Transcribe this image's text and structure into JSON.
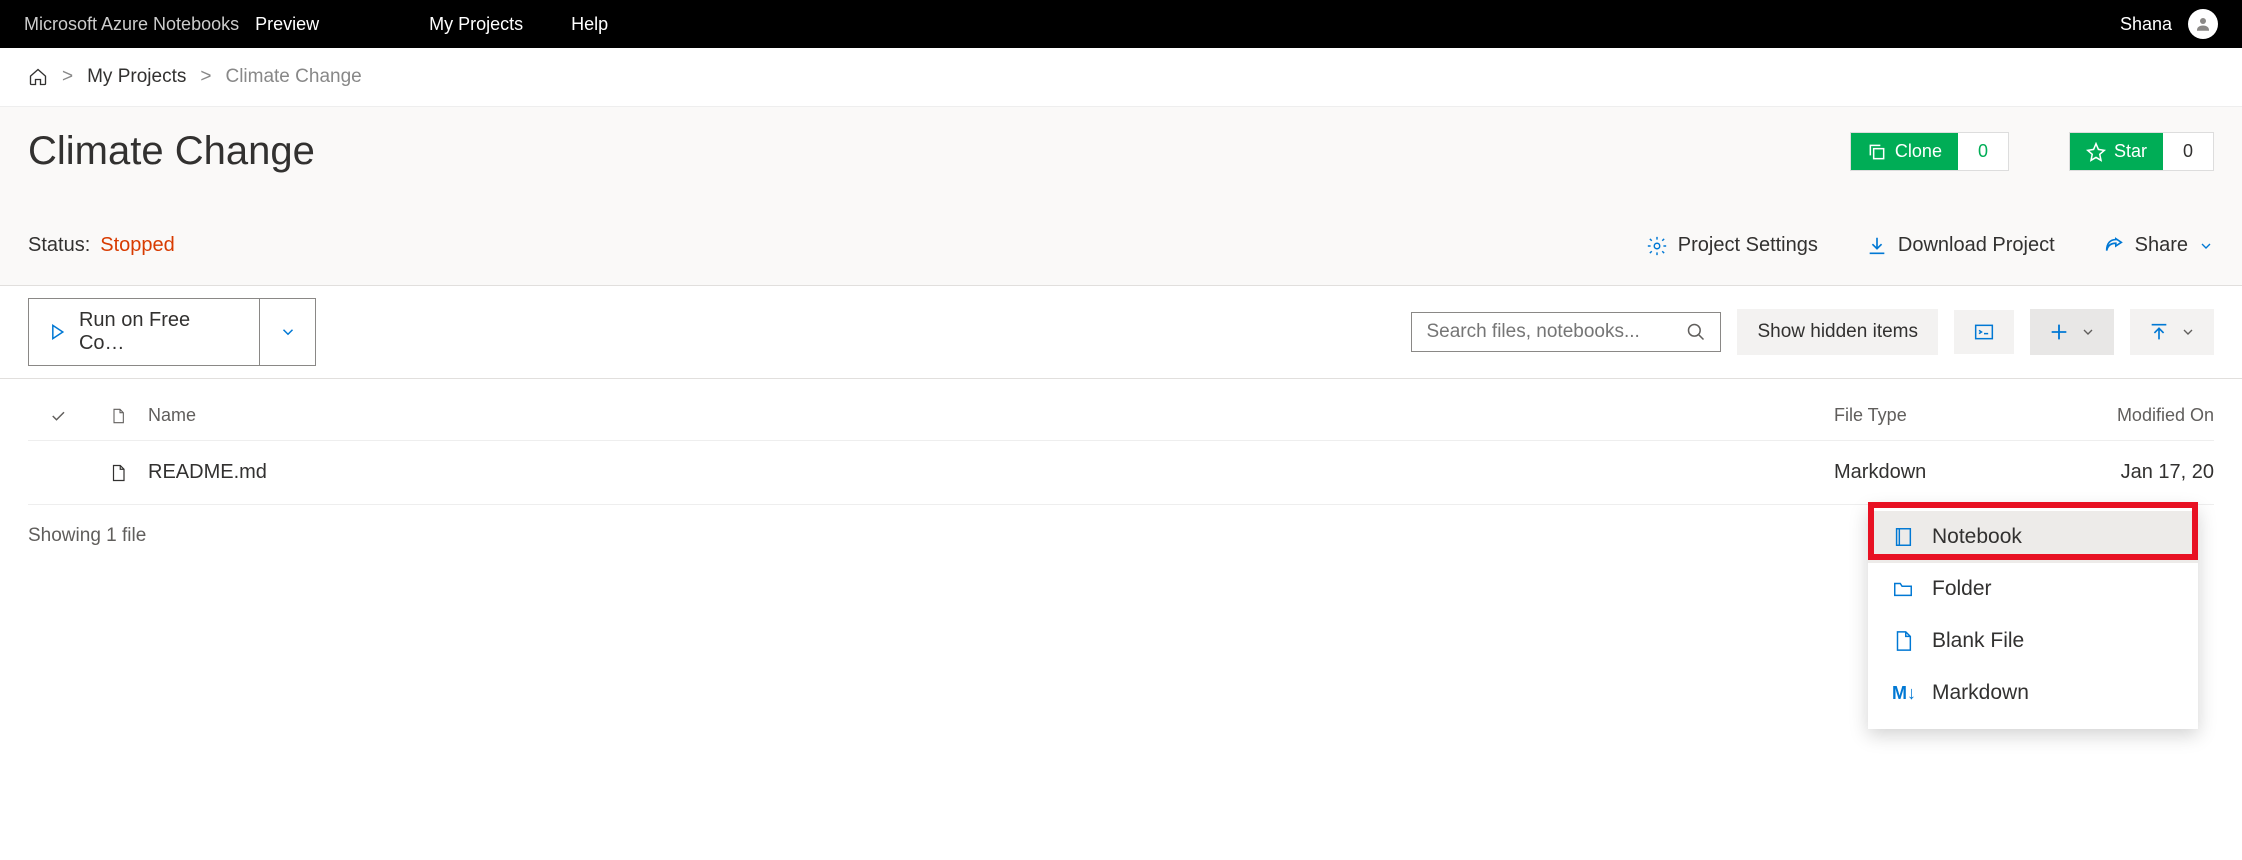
{
  "nav": {
    "brand_main": "Microsoft Azure Notebooks",
    "brand_sub": "Preview",
    "links": {
      "my_projects": "My Projects",
      "help": "Help"
    },
    "user": "Shana"
  },
  "breadcrumb": {
    "my_projects": "My Projects",
    "current": "Climate Change"
  },
  "header": {
    "title": "Climate Change",
    "clone_label": "Clone",
    "clone_count": "0",
    "star_label": "Star",
    "star_count": "0",
    "status_label": "Status:",
    "status_value": "Stopped",
    "project_settings": "Project Settings",
    "download_project": "Download Project",
    "share": "Share"
  },
  "toolbar": {
    "run_label": "Run on Free Co…",
    "show_hidden": "Show hidden items",
    "search_placeholder": "Search files, notebooks..."
  },
  "table": {
    "columns": {
      "name": "Name",
      "type": "File Type",
      "modified": "Modified On"
    },
    "rows": [
      {
        "name": "README.md",
        "type": "Markdown",
        "modified": "Jan 17, 20"
      }
    ],
    "footer": "Showing 1 file"
  },
  "dropdown": {
    "notebook": "Notebook",
    "folder": "Folder",
    "blank_file": "Blank File",
    "markdown": "Markdown"
  }
}
